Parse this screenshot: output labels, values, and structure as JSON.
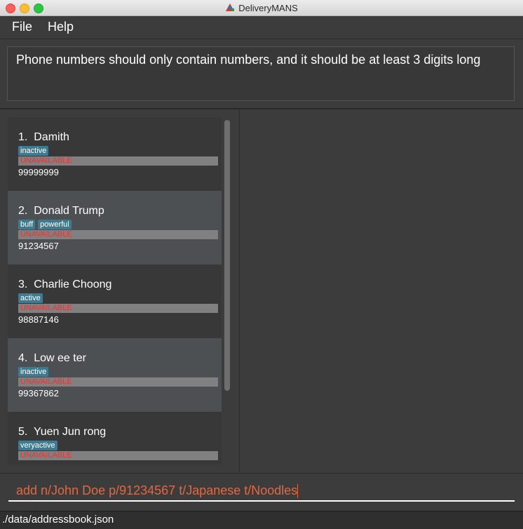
{
  "window": {
    "title": "DeliveryMANS"
  },
  "menu": {
    "file": "File",
    "help": "Help"
  },
  "result": {
    "message": "Phone numbers should only contain numbers, and it should be at least 3 digits long"
  },
  "people": [
    {
      "index": "1.",
      "name": "Damith",
      "tags": [
        "inactive"
      ],
      "status": "UNAVAILABLE",
      "phone": "99999999"
    },
    {
      "index": "2.",
      "name": "Donald Trump",
      "tags": [
        "buff",
        "powerful"
      ],
      "status": "UNAVAILABLE",
      "phone": "91234567"
    },
    {
      "index": "3.",
      "name": "Charlie Choong",
      "tags": [
        "active"
      ],
      "status": "UNAVAILABLE",
      "phone": "98887146"
    },
    {
      "index": "4.",
      "name": "Low ee ter",
      "tags": [
        "inactive"
      ],
      "status": "UNAVAILABLE",
      "phone": "99367862"
    },
    {
      "index": "5.",
      "name": "Yuen Jun rong",
      "tags": [
        "veryactive"
      ],
      "status": "UNAVAILABLE",
      "phone": ""
    }
  ],
  "command": {
    "value": "add n/John Doe p/91234567 t/Japanese t/Noodles"
  },
  "status_bar": {
    "path": "./data/addressbook.json"
  },
  "colors": {
    "tag_bg": "#3e7b91",
    "unavailable_text": "#ff2b2b",
    "command_text": "#e5673f"
  }
}
